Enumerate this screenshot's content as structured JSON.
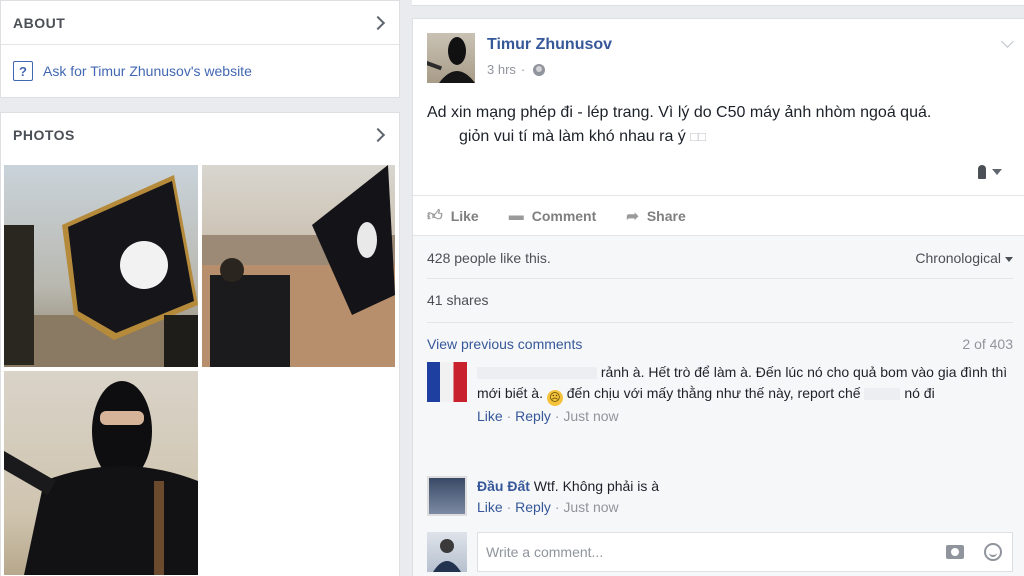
{
  "about": {
    "title": "ABOUT",
    "link_label": "Ask for Timur Zhunusov's website"
  },
  "photos": {
    "title": "PHOTOS"
  },
  "post": {
    "author": "Timur Zhunusov",
    "time": "3 hrs",
    "text_line1": "Ad xin mạng phép đi - lép trang. Vì lý do C50 máy ảnh nhòm ngoá quá.",
    "text_line2": "giỏn vui tí mà làm khó nhau        ra ý",
    "actions": {
      "like": "Like",
      "comment": "Comment",
      "share": "Share"
    },
    "likes_text": "428 people like this.",
    "sort_label": "Chronological",
    "shares_text": "41 shares",
    "view_previous": "View previous comments",
    "comment_count": "2 of 403",
    "comments": [
      {
        "name": "",
        "text": "rảnh à. Hết trò để làm à. Đến lúc nó cho quả bom vào gia đình thì mới biết à.",
        "text2": "đến chịu với mấy thằng như thế này, report chế",
        "text3": "nó đi",
        "like": "Like",
        "reply": "Reply",
        "time": "Just now"
      },
      {
        "name": "Đầu Đất",
        "text": "Wtf. Không phải is à",
        "like": "Like",
        "reply": "Reply",
        "time": "Just now"
      }
    ],
    "composer_placeholder": "Write a comment..."
  },
  "colors": {
    "link": "#365899",
    "background": "#e9ebee",
    "muted": "#90949c"
  }
}
